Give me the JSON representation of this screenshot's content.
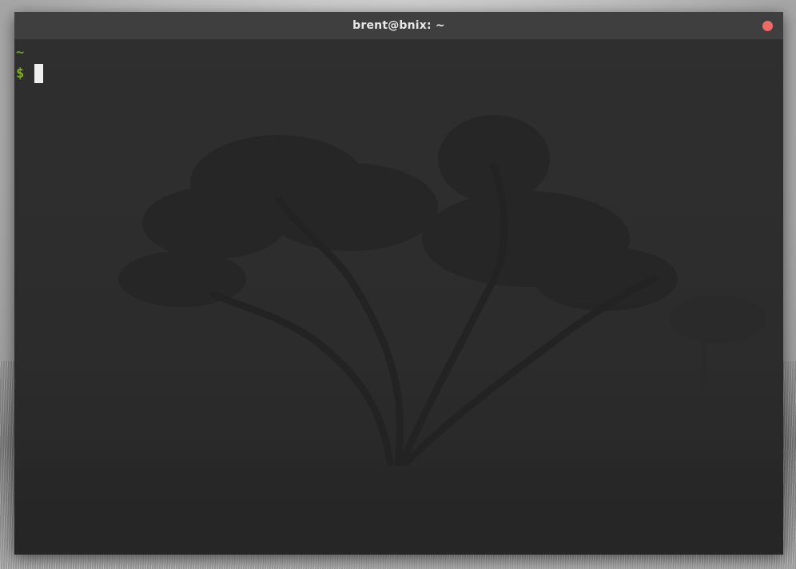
{
  "window": {
    "title": "brent@bnix: ~"
  },
  "terminal": {
    "cwd": "~",
    "prompt_symbol": "$",
    "input": ""
  },
  "colors": {
    "titlebar": "#3f3f3f",
    "terminal_bg": "#2b2b2b",
    "close_button": "#ed6a6a",
    "prompt_green": "#7fb118",
    "cursor": "#efefef"
  },
  "icons": {
    "close": "close-dot-icon"
  }
}
